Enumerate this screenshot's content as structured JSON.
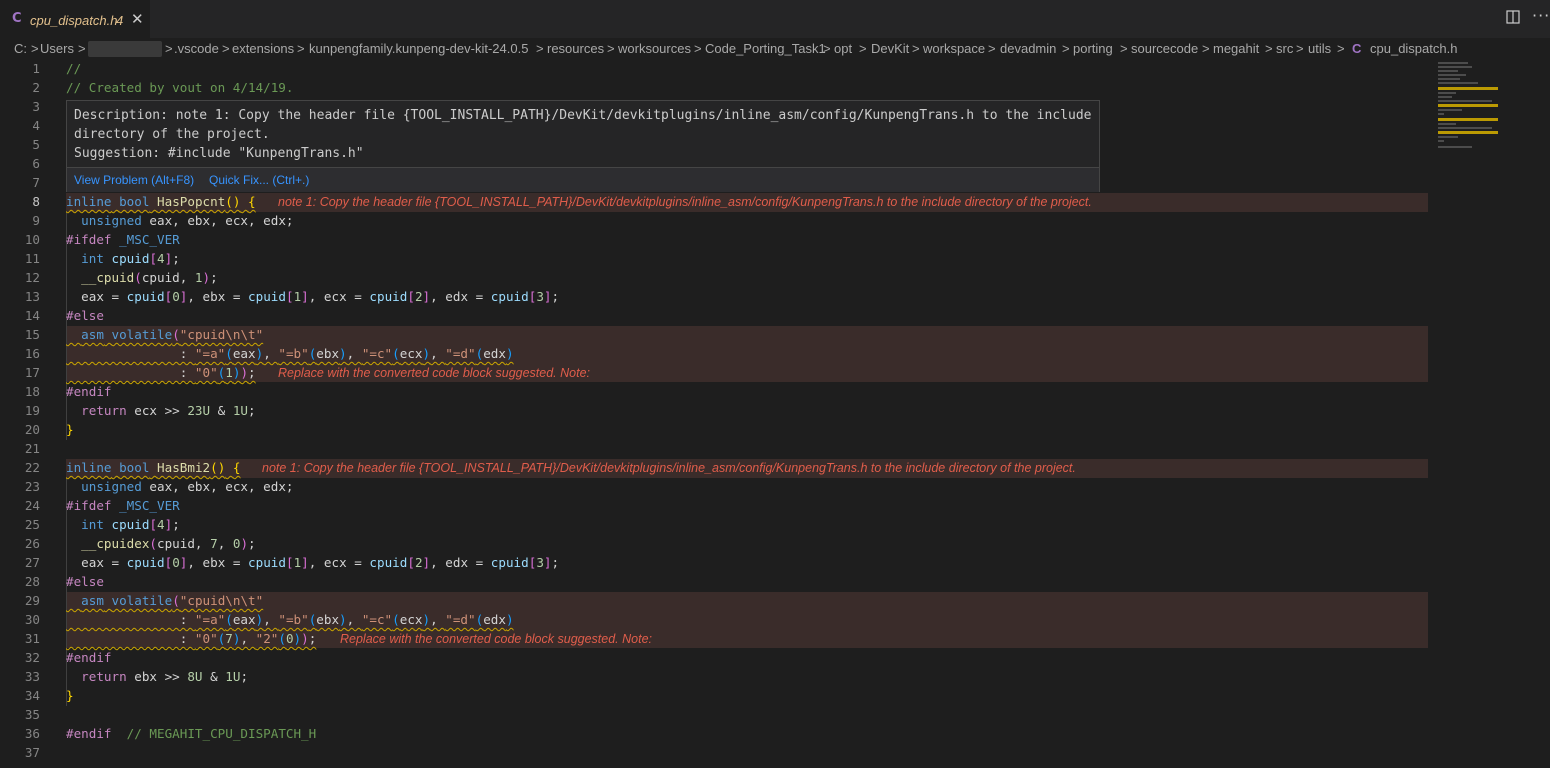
{
  "tab": {
    "icon": "C",
    "name": "cpu_dispatch.h",
    "problem_count": "4",
    "close_glyph": "✕"
  },
  "toolbar": {
    "split_icon": "split-editor-icon",
    "more_glyph": "···"
  },
  "breadcrumb": {
    "items": [
      "C:",
      "Users",
      "",
      ".vscode",
      "extensions",
      "kunpengfamily.kunpeng-dev-kit-24.0.5",
      "resources",
      "worksources",
      "Code_Porting_Task1",
      "opt",
      "DevKit",
      "workspace",
      "devadmin",
      "porting",
      "sourcecode",
      "megahit",
      "src",
      "utils"
    ],
    "file_icon": "C",
    "file": "cpu_dispatch.h",
    "separator": ">"
  },
  "hover": {
    "line1": "Description: note 1: Copy the header file {TOOL_INSTALL_PATH}/DevKit/devkitplugins/inline_asm/config/KunpengTrans.h to the include",
    "line2": "directory of the project.",
    "line3": "Suggestion: #include \"KunpengTrans.h\"",
    "view_problem": "View Problem (Alt+F8)",
    "quick_fix": "Quick Fix... (Ctrl+.)"
  },
  "line_numbers": [
    "1",
    "2",
    "3",
    "4",
    "5",
    "6",
    "7",
    "8",
    "9",
    "10",
    "11",
    "12",
    "13",
    "14",
    "15",
    "16",
    "17",
    "18",
    "19",
    "20",
    "21",
    "22",
    "23",
    "24",
    "25",
    "26",
    "27",
    "28",
    "29",
    "30",
    "31",
    "32",
    "33",
    "34",
    "35",
    "36",
    "37"
  ],
  "diagnostics": {
    "note_copy_header": "note 1: Copy the header file {TOOL_INSTALL_PATH}/DevKit/devkitplugins/inline_asm/config/KunpengTrans.h to the include directory of the project.",
    "replace_block": "Replace with the converted code block suggested. Note:"
  },
  "code": {
    "l1": "//",
    "l2": "// Created by vout on 4/14/19.",
    "l36_comment": "// MEGAHIT_CPU_DISPATCH_H"
  },
  "colors": {
    "background": "#1e1e1e",
    "error_text": "#e05d4b",
    "warning_squiggle": "#cca700",
    "keyword": "#569cd6",
    "string": "#ce9178"
  }
}
